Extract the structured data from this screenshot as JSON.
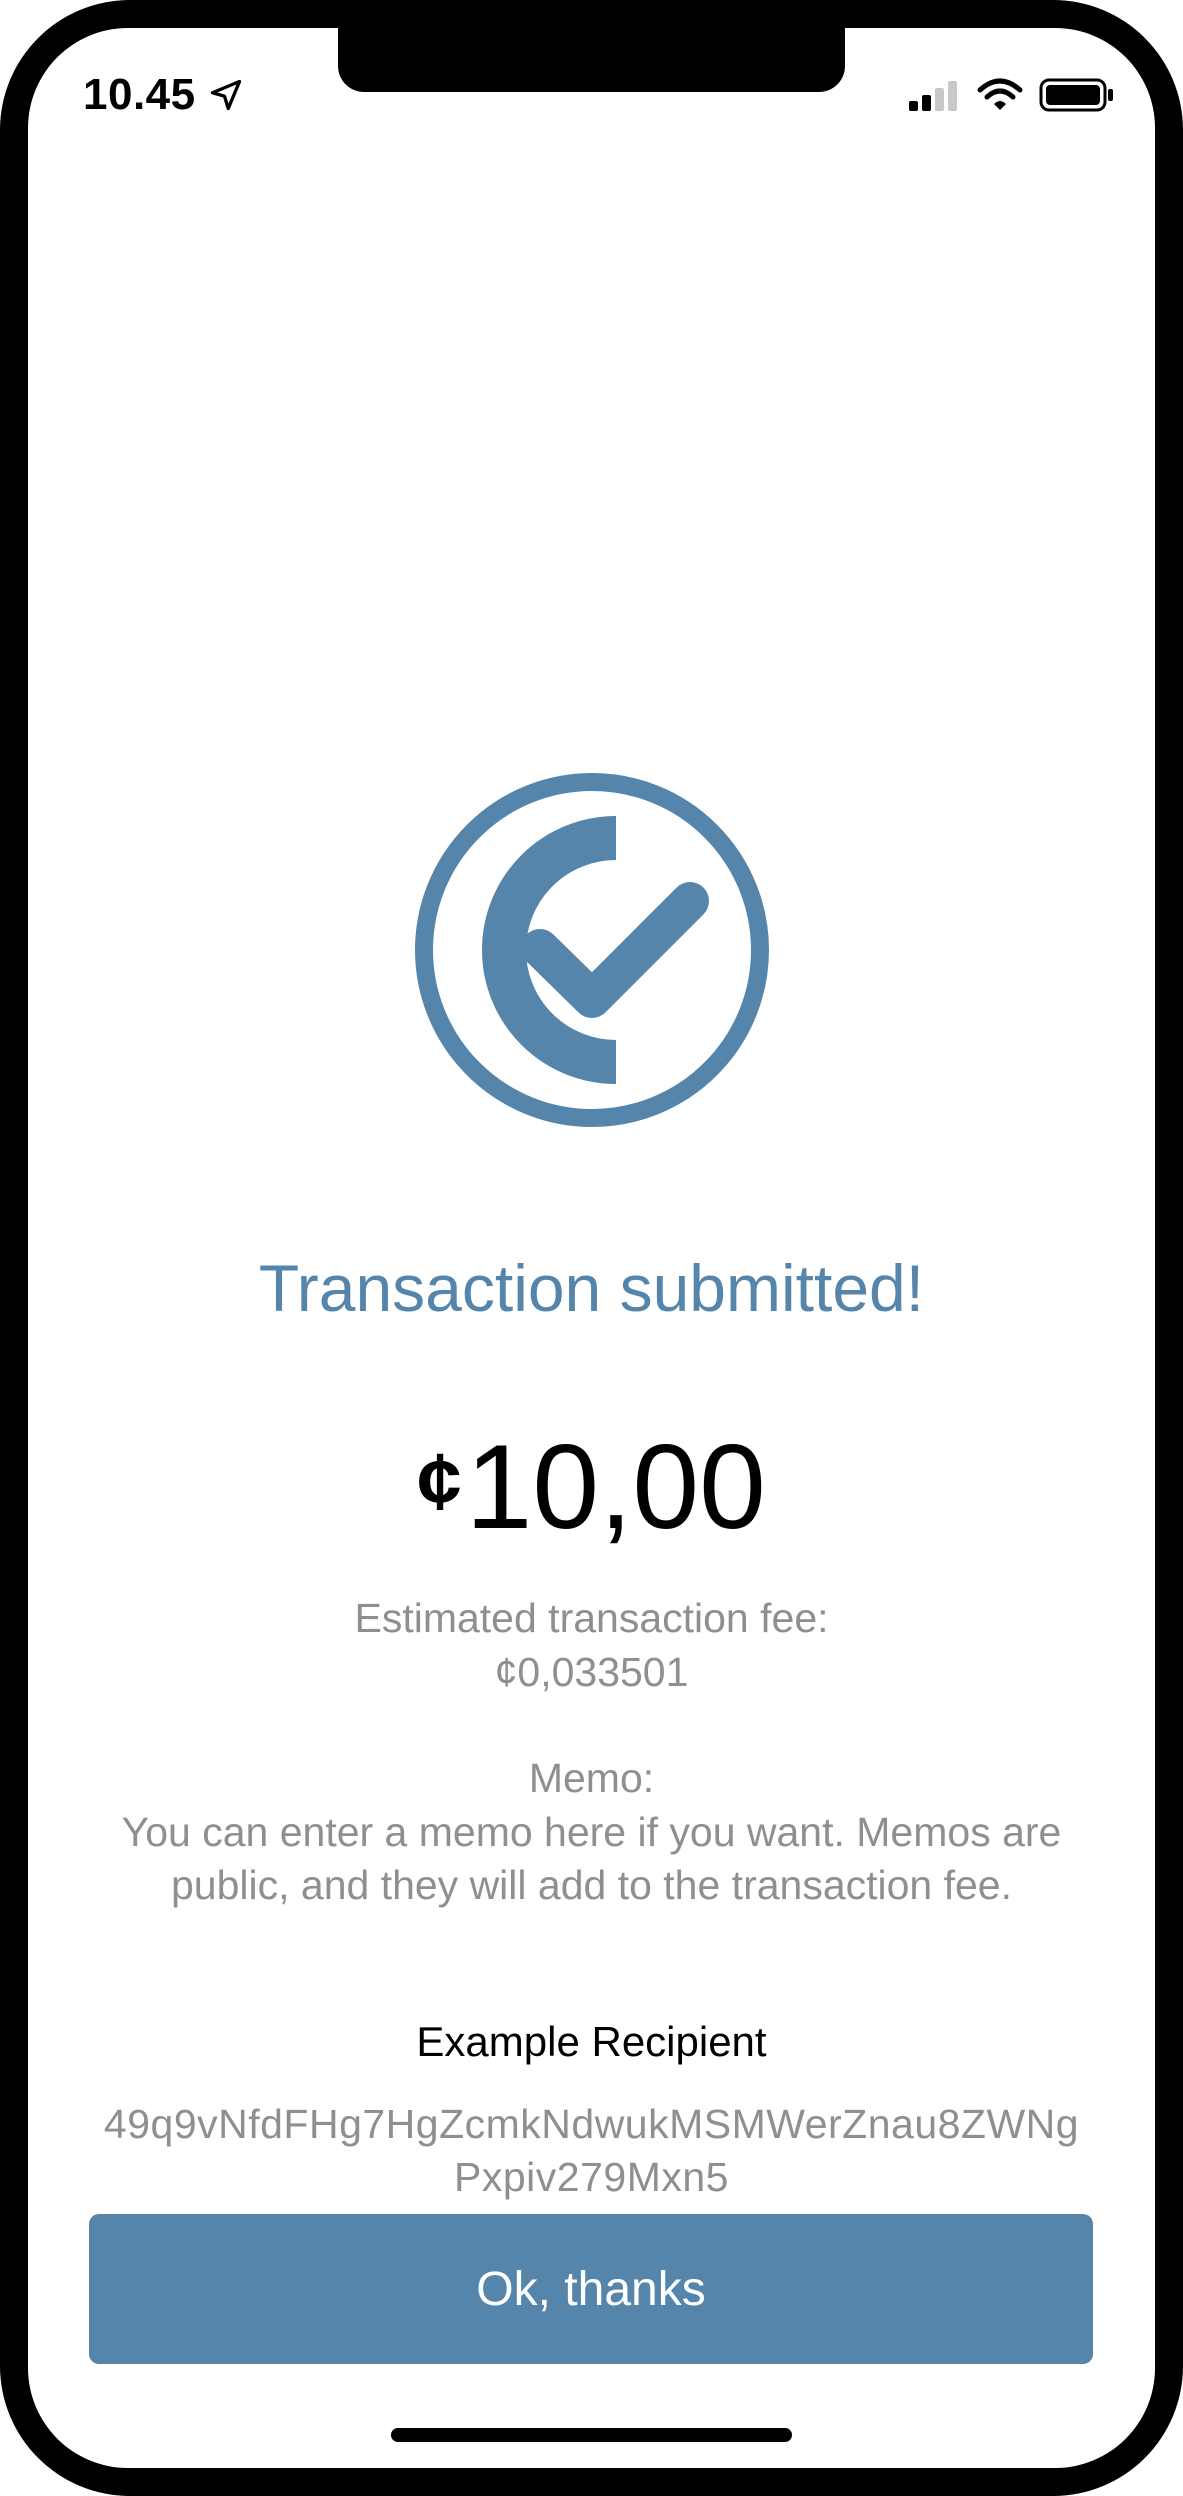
{
  "status_bar": {
    "time": "10.45",
    "location_icon": "location-arrow-icon",
    "signal_icon": "cellular-signal-icon",
    "wifi_icon": "wifi-icon",
    "battery_icon": "battery-icon"
  },
  "success": {
    "icon": "check-circle-icon",
    "title": "Transaction submitted!"
  },
  "amount": {
    "currency_symbol": "¢",
    "value": "10,00"
  },
  "fee": {
    "label": "Estimated transaction fee:",
    "value": "¢0,033501"
  },
  "memo": {
    "label": "Memo:",
    "text": "You can enter a memo here if you want. Memos are public, and they will add to the transaction fee."
  },
  "recipient": {
    "name": "Example Recipient",
    "address": "49q9vNfdFHg7HgZcmkNdwukMSMWerZnau8ZWNgPxpiv279Mxn5"
  },
  "actions": {
    "ok_label": "Ok, thanks"
  },
  "colors": {
    "accent": "#5585ab",
    "muted_text": "#8f8f8f"
  }
}
